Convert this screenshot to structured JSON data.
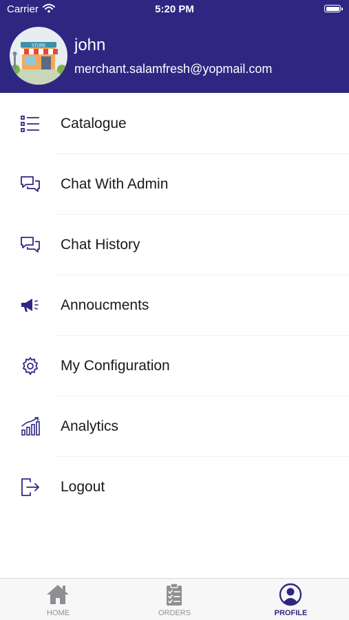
{
  "status_bar": {
    "carrier": "Carrier",
    "time": "5:20 PM"
  },
  "profile": {
    "name": "john",
    "email": "merchant.salamfresh@yopmail.com",
    "avatar_sign": "STORE"
  },
  "menu": {
    "items": [
      {
        "label": "Catalogue",
        "icon": "list-icon"
      },
      {
        "label": "Chat With Admin",
        "icon": "chat-bubbles-icon"
      },
      {
        "label": "Chat History",
        "icon": "chat-bubbles-icon"
      },
      {
        "label": "Annoucments",
        "icon": "megaphone-icon"
      },
      {
        "label": "My Configuration",
        "icon": "gear-icon"
      },
      {
        "label": "Analytics",
        "icon": "chart-icon"
      },
      {
        "label": "Logout",
        "icon": "logout-icon"
      }
    ]
  },
  "tabbar": {
    "tabs": [
      {
        "label": "HOME",
        "icon": "home-icon",
        "active": false
      },
      {
        "label": "ORDERS",
        "icon": "clipboard-icon",
        "active": false
      },
      {
        "label": "PROFILE",
        "icon": "user-circle-icon",
        "active": true
      }
    ]
  },
  "colors": {
    "primary": "#2e2782",
    "inactive": "#8e8e93",
    "text": "#1a1a1a"
  }
}
